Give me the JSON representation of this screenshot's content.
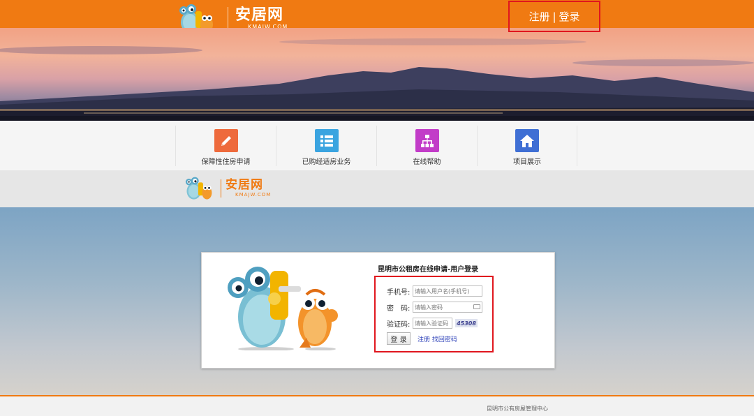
{
  "header": {
    "logo_cn": "安居网",
    "logo_en": "KMAJW.COM",
    "register_label": "注册",
    "separator": "|",
    "login_label": "登录"
  },
  "nav": {
    "items": [
      {
        "label": "保障性住房申请",
        "icon": "pencil-icon",
        "color": "#ee6a3c"
      },
      {
        "label": "已购经适房业务",
        "icon": "list-icon",
        "color": "#3aa4e0"
      },
      {
        "label": "在线帮助",
        "icon": "sitemap-icon",
        "color": "#c23cc8"
      },
      {
        "label": "项目展示",
        "icon": "home-icon",
        "color": "#3f6fd4"
      }
    ]
  },
  "subheader": {
    "logo_cn": "安居网",
    "logo_en": "KMAJW.COM"
  },
  "login": {
    "title": "昆明市公租房在线申请-用户登录",
    "phone_label": "手机号:",
    "phone_placeholder": "请输入用户名(手机号)",
    "password_label": "密　码:",
    "password_placeholder": "请输入密码",
    "captcha_label": "验证码:",
    "captcha_placeholder": "请输入验证码",
    "captcha_value": "45308",
    "submit_label": "登 录",
    "register_link": "注册",
    "recover_link": "找回密码"
  },
  "footer": {
    "text": "昆明市公有房屋管理中心"
  },
  "colors": {
    "brand_orange": "#f07a12",
    "highlight_red": "#e0161e",
    "link_blue": "#2b3fb8"
  }
}
